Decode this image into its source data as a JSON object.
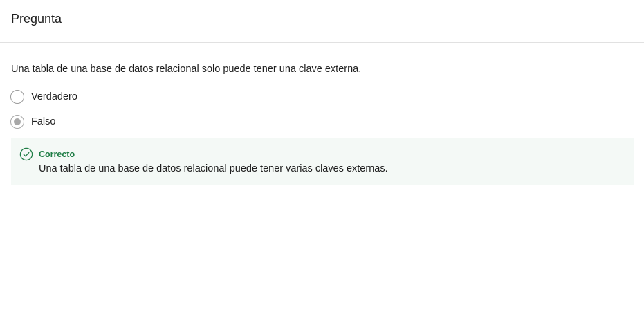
{
  "header": {
    "title": "Pregunta"
  },
  "question": {
    "text": "Una tabla de una base de datos relacional solo puede tener una clave externa.",
    "options": [
      {
        "label": "Verdadero",
        "selected": false
      },
      {
        "label": "Falso",
        "selected": true
      }
    ]
  },
  "feedback": {
    "status": "Correcto",
    "explanation": "Una tabla de una base de datos relacional puede tener varias claves externas.",
    "icon": "check-circle-icon",
    "status_color": "#1e7d45",
    "background_color": "#f4f9f6"
  }
}
